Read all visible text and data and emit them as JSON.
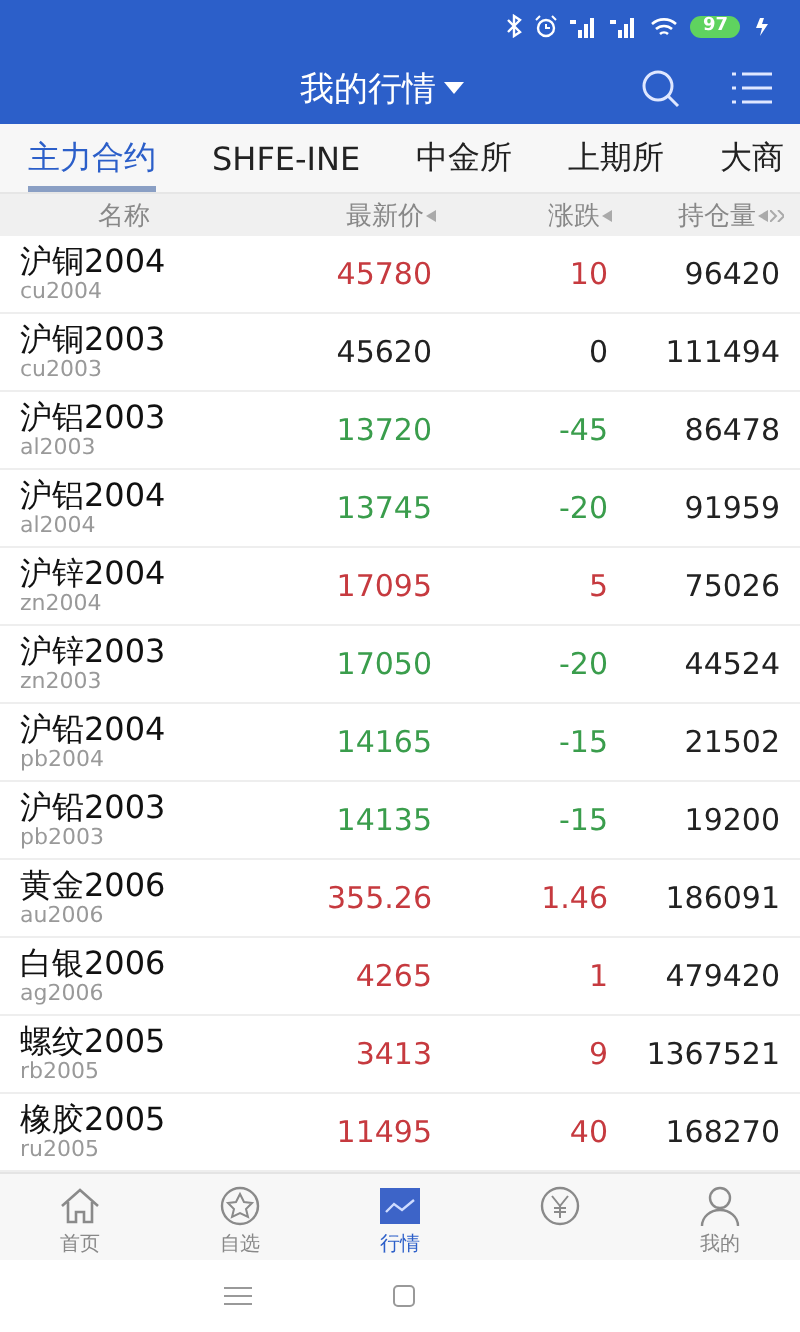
{
  "status_bar": {
    "battery": "97"
  },
  "header": {
    "title": "我的行情"
  },
  "tabs": [
    {
      "label": "主力合约",
      "selected": true
    },
    {
      "label": "SHFE-INE",
      "selected": false
    },
    {
      "label": "中金所",
      "selected": false
    },
    {
      "label": "上期所",
      "selected": false
    },
    {
      "label": "大商",
      "selected": false
    }
  ],
  "table": {
    "columns": [
      {
        "label": "名称",
        "kind": "plain"
      },
      {
        "label": "最新价",
        "kind": "sortable"
      },
      {
        "label": "涨跌",
        "kind": "sortable"
      },
      {
        "label": "持仓量",
        "kind": "sortable"
      }
    ],
    "rows": [
      {
        "name": "沪铜2004",
        "code": "cu2004",
        "price": "45780",
        "change": "10",
        "open_interest": "96420",
        "color": "#c63a3f"
      },
      {
        "name": "沪铜2003",
        "code": "cu2003",
        "price": "45620",
        "change": "0",
        "open_interest": "111494",
        "color": "#222222"
      },
      {
        "name": "沪铝2003",
        "code": "al2003",
        "price": "13720",
        "change": "-45",
        "open_interest": "86478",
        "color": "#3a9d4c"
      },
      {
        "name": "沪铝2004",
        "code": "al2004",
        "price": "13745",
        "change": "-20",
        "open_interest": "91959",
        "color": "#3a9d4c"
      },
      {
        "name": "沪锌2004",
        "code": "zn2004",
        "price": "17095",
        "change": "5",
        "open_interest": "75026",
        "color": "#c63a3f"
      },
      {
        "name": "沪锌2003",
        "code": "zn2003",
        "price": "17050",
        "change": "-20",
        "open_interest": "44524",
        "color": "#3a9d4c"
      },
      {
        "name": "沪铅2004",
        "code": "pb2004",
        "price": "14165",
        "change": "-15",
        "open_interest": "21502",
        "color": "#3a9d4c"
      },
      {
        "name": "沪铅2003",
        "code": "pb2003",
        "price": "14135",
        "change": "-15",
        "open_interest": "19200",
        "color": "#3a9d4c"
      },
      {
        "name": "黄金2006",
        "code": "au2006",
        "price": "355.26",
        "change": "1.46",
        "open_interest": "186091",
        "color": "#c63a3f"
      },
      {
        "name": "白银2006",
        "code": "ag2006",
        "price": "4265",
        "change": "1",
        "open_interest": "479420",
        "color": "#c63a3f"
      },
      {
        "name": "螺纹2005",
        "code": "rb2005",
        "price": "3413",
        "change": "9",
        "open_interest": "1367521",
        "color": "#c63a3f"
      },
      {
        "name": "橡胶2005",
        "code": "ru2005",
        "price": "11495",
        "change": "40",
        "open_interest": "168270",
        "color": "#c63a3f"
      }
    ]
  },
  "bottom_nav": [
    {
      "kind": "home",
      "label": "首页",
      "selected": false
    },
    {
      "kind": "star",
      "label": "自选",
      "selected": false
    },
    {
      "kind": "chart",
      "label": "行情",
      "selected": true
    },
    {
      "kind": "yen",
      "selected": false
    },
    {
      "kind": "person",
      "label": "我的",
      "selected": false
    }
  ]
}
